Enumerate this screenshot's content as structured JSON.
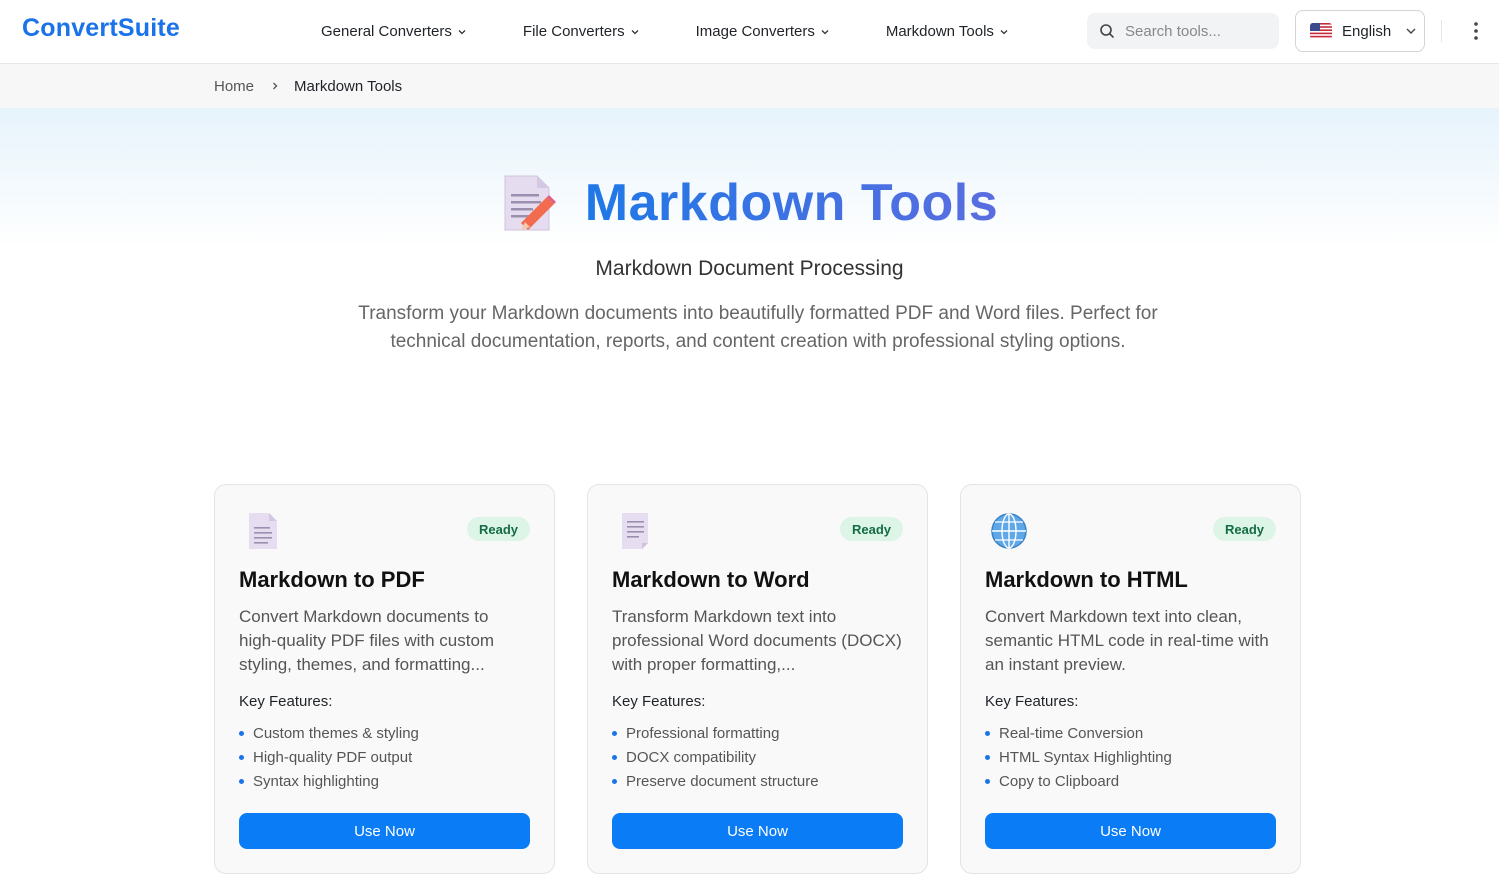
{
  "header": {
    "logo": "ConvertSuite",
    "nav": [
      {
        "label": "General Converters"
      },
      {
        "label": "File Converters"
      },
      {
        "label": "Image Converters"
      },
      {
        "label": "Markdown Tools"
      }
    ],
    "search_placeholder": "Search tools...",
    "language": "English"
  },
  "breadcrumb": {
    "home": "Home",
    "current": "Markdown Tools"
  },
  "hero": {
    "title": "Markdown Tools",
    "subtitle": "Markdown Document Processing",
    "description": "Transform your Markdown documents into beautifully formatted PDF and Word files. Perfect for technical documentation, reports, and content creation with professional styling options."
  },
  "cards": [
    {
      "icon": "document-icon",
      "badge": "Ready",
      "title": "Markdown to PDF",
      "description": "Convert Markdown documents to high-quality PDF files with custom styling, themes, and formatting...",
      "features_label": "Key Features:",
      "features": [
        "Custom themes & styling",
        "High-quality PDF output",
        "Syntax highlighting"
      ],
      "button": "Use Now"
    },
    {
      "icon": "page-icon",
      "badge": "Ready",
      "title": "Markdown to Word",
      "description": "Transform Markdown text into professional Word documents (DOCX) with proper formatting,...",
      "features_label": "Key Features:",
      "features": [
        "Professional formatting",
        "DOCX compatibility",
        "Preserve document structure"
      ],
      "button": "Use Now"
    },
    {
      "icon": "globe-icon",
      "badge": "Ready",
      "title": "Markdown to HTML",
      "description": "Convert Markdown text into clean, semantic HTML code in real-time with an instant preview.",
      "features_label": "Key Features:",
      "features": [
        "Real-time Conversion",
        "HTML Syntax Highlighting",
        "Copy to Clipboard"
      ],
      "button": "Use Now"
    }
  ],
  "colors": {
    "brand": "#1a73e8",
    "button": "#0a7cf5",
    "badge_bg": "#dcf5e6",
    "badge_text": "#146c43"
  }
}
